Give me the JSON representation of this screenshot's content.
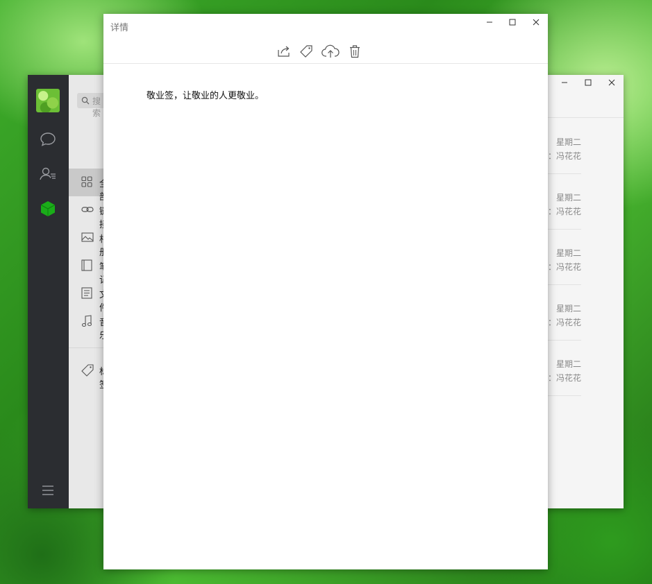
{
  "main_window": {
    "search_placeholder": "搜索",
    "favorites_menu": [
      {
        "label": "全部",
        "icon": "grid-icon"
      },
      {
        "label": "链接",
        "icon": "link-icon"
      },
      {
        "label": "相册",
        "icon": "image-icon"
      },
      {
        "label": "笔记",
        "icon": "notebook-icon"
      },
      {
        "label": "文件",
        "icon": "document-icon"
      },
      {
        "label": "音乐",
        "icon": "music-icon"
      }
    ],
    "tags_label": "标签",
    "list": [
      {
        "day": "星期二",
        "from": "：冯花花"
      },
      {
        "day": "星期二",
        "from": "：冯花花"
      },
      {
        "day": "星期二",
        "from": "：冯花花"
      },
      {
        "day": "星期二",
        "from": "：冯花花"
      },
      {
        "day": "星期二",
        "from": "：冯花花"
      }
    ]
  },
  "detail_window": {
    "title": "详情",
    "content": "敬业签，让敬业的人更敬业。"
  },
  "colors": {
    "accent_green": "#1aad19",
    "sidebar_dark": "#2b2d31"
  }
}
